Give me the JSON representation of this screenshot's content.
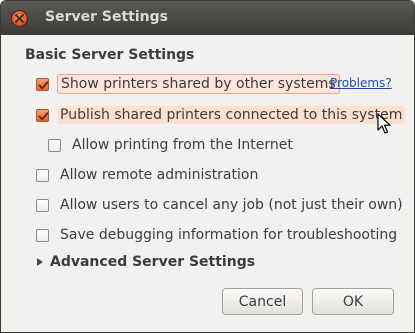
{
  "window": {
    "title": "Server Settings"
  },
  "section": {
    "title": "Basic Server Settings"
  },
  "options": [
    {
      "label": "Show printers shared by other systems",
      "checked": true
    },
    {
      "label": "Publish shared printers connected to this system",
      "checked": true
    },
    {
      "label": "Allow printing from the Internet",
      "checked": false
    },
    {
      "label": "Allow remote administration",
      "checked": false
    },
    {
      "label": "Allow users to cancel any job (not just their own)",
      "checked": false
    },
    {
      "label": "Save debugging information for troubleshooting",
      "checked": false
    }
  ],
  "problems_link": "Problems?",
  "advanced": {
    "label": "Advanced Server Settings",
    "expanded": false
  },
  "buttons": {
    "cancel": "Cancel",
    "ok": "OK"
  },
  "colors": {
    "accent": "#e2632d",
    "titlebar": "#3c3b37",
    "link": "#1d4fb3"
  }
}
